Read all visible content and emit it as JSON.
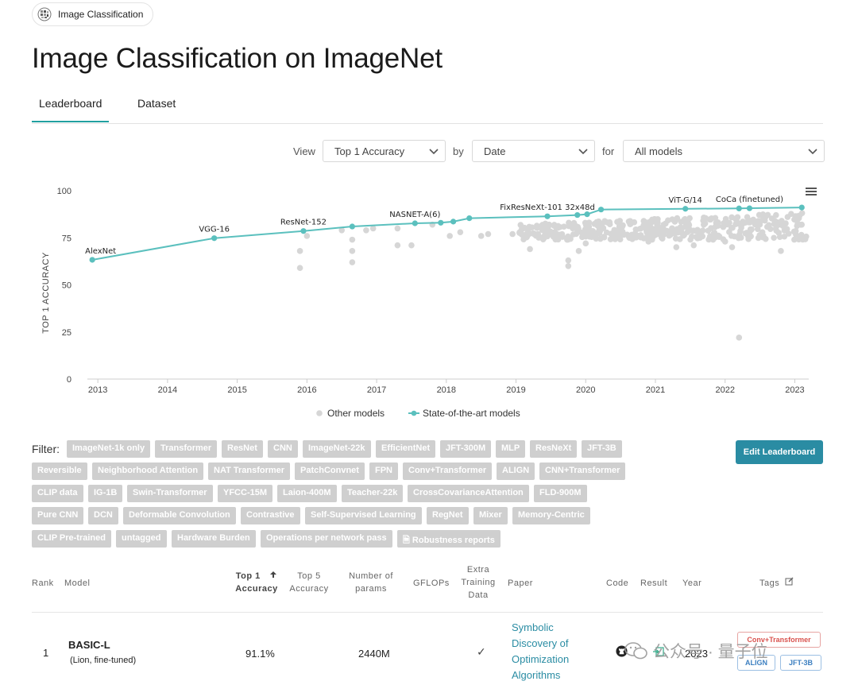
{
  "breadcrumb": {
    "label": "Image Classification"
  },
  "page_title": "Image Classification on ImageNet",
  "tabs": [
    {
      "label": "Leaderboard",
      "active": true
    },
    {
      "label": "Dataset",
      "active": false
    }
  ],
  "controls": {
    "view_label": "View",
    "view_value": "Top 1 Accuracy",
    "by_label": "by",
    "by_value": "Date",
    "for_label": "for",
    "for_value": "All models"
  },
  "chart_data": {
    "type": "scatter",
    "ylabel": "TOP 1 ACCURACY",
    "ylim": [
      0,
      100
    ],
    "yticks": [
      0,
      25,
      50,
      75,
      100
    ],
    "xlim": [
      2012.85,
      2023.2
    ],
    "xticks": [
      "2013",
      "2014",
      "2015",
      "2016",
      "2017",
      "2018",
      "2019",
      "2020",
      "2021",
      "2022",
      "2023"
    ],
    "grid": false,
    "legend_position": "bottom",
    "series": [
      {
        "name": "State-of-the-art models",
        "color": "#5bc0be",
        "points": [
          {
            "x": 2012.92,
            "y": 63.3,
            "label": "AlexNet"
          },
          {
            "x": 2014.67,
            "y": 74.8,
            "label": "VGG-16"
          },
          {
            "x": 2015.95,
            "y": 78.6,
            "label": "ResNet-152"
          },
          {
            "x": 2016.65,
            "y": 81.0
          },
          {
            "x": 2017.55,
            "y": 82.7,
            "label": "NASNET-A(6)"
          },
          {
            "x": 2017.92,
            "y": 83.0
          },
          {
            "x": 2018.1,
            "y": 83.6
          },
          {
            "x": 2018.33,
            "y": 85.4
          },
          {
            "x": 2019.45,
            "y": 86.4,
            "label": "FixResNeXt-101 32x48d"
          },
          {
            "x": 2019.88,
            "y": 87.1
          },
          {
            "x": 2020.02,
            "y": 87.5
          },
          {
            "x": 2020.22,
            "y": 90.0
          },
          {
            "x": 2021.43,
            "y": 90.4,
            "label": "ViT-G/14"
          },
          {
            "x": 2022.2,
            "y": 90.6
          },
          {
            "x": 2022.35,
            "y": 90.7,
            "label": "CoCa (finetuned)"
          },
          {
            "x": 2023.1,
            "y": 91.1
          }
        ]
      },
      {
        "name": "Other models",
        "color": "#d6d6d6",
        "points": [
          {
            "x": 2015.9,
            "y": 59
          },
          {
            "x": 2015.9,
            "y": 68
          },
          {
            "x": 2016.0,
            "y": 76
          },
          {
            "x": 2016.5,
            "y": 79
          },
          {
            "x": 2016.65,
            "y": 62
          },
          {
            "x": 2016.65,
            "y": 68
          },
          {
            "x": 2016.65,
            "y": 74
          },
          {
            "x": 2016.85,
            "y": 79
          },
          {
            "x": 2016.95,
            "y": 80
          },
          {
            "x": 2017.3,
            "y": 71
          },
          {
            "x": 2017.5,
            "y": 71
          },
          {
            "x": 2017.3,
            "y": 80
          },
          {
            "x": 2017.8,
            "y": 82
          },
          {
            "x": 2018.05,
            "y": 76
          },
          {
            "x": 2018.2,
            "y": 78
          },
          {
            "x": 2018.5,
            "y": 76
          },
          {
            "x": 2018.6,
            "y": 77
          },
          {
            "x": 2018.95,
            "y": 77
          },
          {
            "x": 2019.1,
            "y": 80
          },
          {
            "x": 2019.2,
            "y": 69
          },
          {
            "x": 2019.75,
            "y": 60
          },
          {
            "x": 2019.75,
            "y": 63
          },
          {
            "x": 2019.9,
            "y": 68
          },
          {
            "x": 2020.0,
            "y": 72
          },
          {
            "x": 2020.9,
            "y": 73
          },
          {
            "x": 2021.3,
            "y": 70
          },
          {
            "x": 2021.55,
            "y": 71
          },
          {
            "x": 2022.0,
            "y": 73
          },
          {
            "x": 2022.1,
            "y": 70
          },
          {
            "x": 2022.7,
            "y": 75
          },
          {
            "x": 2022.8,
            "y": 68
          },
          {
            "x": 2023.1,
            "y": 82
          },
          {
            "x": 2022.2,
            "y": 22
          }
        ],
        "dense_band": {
          "x_range": [
            2019.05,
            2023.2
          ],
          "y_range": [
            74,
            88.5
          ]
        }
      }
    ]
  },
  "filter": {
    "label": "Filter:",
    "chips": [
      [
        "ImageNet-1k only",
        "Transformer",
        "ResNet",
        "CNN",
        "ImageNet-22k",
        "EfficientNet",
        "JFT-300M",
        "MLP",
        "ResNeXt",
        "JFT-3B"
      ],
      [
        "Reversible",
        "Neighborhood Attention",
        "NAT Transformer",
        "PatchConvnet",
        "FPN",
        "Conv+Transformer",
        "ALIGN",
        "CNN+Transformer"
      ],
      [
        "CLIP data",
        "IG-1B",
        "Swin-Transformer",
        "YFCC-15M",
        "Laion-400M",
        "Teacher-22k",
        "CrossCovarianceAttention",
        "FLD-900M"
      ],
      [
        "Pure CNN",
        "DCN",
        "Deformable Convolution",
        "Contrastive",
        "Self-Supervised Learning",
        "RegNet",
        "Mixer",
        "Memory-Centric"
      ],
      [
        "CLIP Pre-trained",
        "untagged",
        "Hardware Burden",
        "Operations per network pass",
        "Robustness reports"
      ]
    ],
    "edit_button": "Edit Leaderboard"
  },
  "table": {
    "headers": {
      "rank": "Rank",
      "model": "Model",
      "top1": [
        "Top 1",
        "Accuracy"
      ],
      "top5": [
        "Top 5",
        "Accuracy"
      ],
      "params": [
        "Number of",
        "params"
      ],
      "gflops": "GFLOPs",
      "extra": [
        "Extra",
        "Training",
        "Data"
      ],
      "paper": "Paper",
      "code": "Code",
      "result": "Result",
      "year": "Year",
      "tags": "Tags"
    },
    "rows": [
      {
        "rank": "1",
        "model": "BASIC-L",
        "model_sub": "(Lion, fine-tuned)",
        "top1": "91.1%",
        "params": "2440M",
        "extra": "✓",
        "paper": [
          "Symbolic",
          "Discovery of",
          "Optimization",
          "Algorithms"
        ],
        "year": "2023",
        "tags": [
          "Conv+Transformer",
          "ALIGN",
          "JFT-3B"
        ]
      }
    ]
  },
  "watermark": {
    "text": "公众号 · 量子位"
  }
}
